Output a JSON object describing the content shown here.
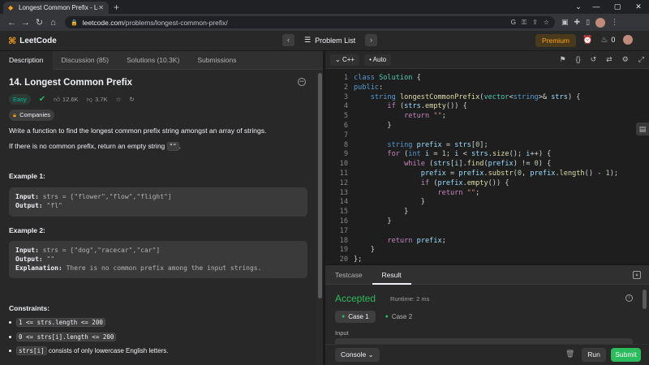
{
  "browser": {
    "tab_title": "Longest Common Prefix - LeetCode",
    "url_host": "leetcode.com",
    "url_path": "/problems/longest-common-prefix/"
  },
  "nav": {
    "logo_text": "LeetCode",
    "problem_list": "Problem List",
    "premium": "Premium",
    "streak_count": "0"
  },
  "left_tabs": [
    "Description",
    "Discussion (85)",
    "Solutions (10.3K)",
    "Submissions"
  ],
  "problem": {
    "title": "14. Longest Common Prefix",
    "difficulty": "Easy",
    "likes": "12.6K",
    "dislikes": "3.7K",
    "companies": "Companies",
    "desc1": "Write a function to find the longest common prefix string amongst an array of strings.",
    "desc2_pre": "If there is no common prefix, return an empty string ",
    "desc2_code": "\"\"",
    "desc2_post": ".",
    "ex1_label": "Example 1:",
    "ex1_input_label": "Input:",
    "ex1_input": " strs = [\"flower\",\"flow\",\"flight\"]",
    "ex1_output_label": "Output:",
    "ex1_output": " \"fl\"",
    "ex2_label": "Example 2:",
    "ex2_input_label": "Input:",
    "ex2_input": " strs = [\"dog\",\"racecar\",\"car\"]",
    "ex2_output_label": "Output:",
    "ex2_output": " \"\"",
    "ex2_expl_label": "Explanation:",
    "ex2_expl": " There is no common prefix among the input strings.",
    "constraints_label": "Constraints:",
    "c1": "1 <= strs.length <= 200",
    "c2": "0 <= strs[i].length <= 200",
    "c3_code": "strs[i]",
    "c3_text": " consists of only lowercase English letters."
  },
  "editor": {
    "language": "C++",
    "mode": "Auto"
  },
  "bottom": {
    "tab_testcase": "Testcase",
    "tab_result": "Result",
    "status": "Accepted",
    "runtime": "Runtime: 2 ms",
    "case1": "Case 1",
    "case2": "Case 2",
    "input_label": "Input",
    "console": "Console",
    "run": "Run",
    "submit": "Submit"
  }
}
